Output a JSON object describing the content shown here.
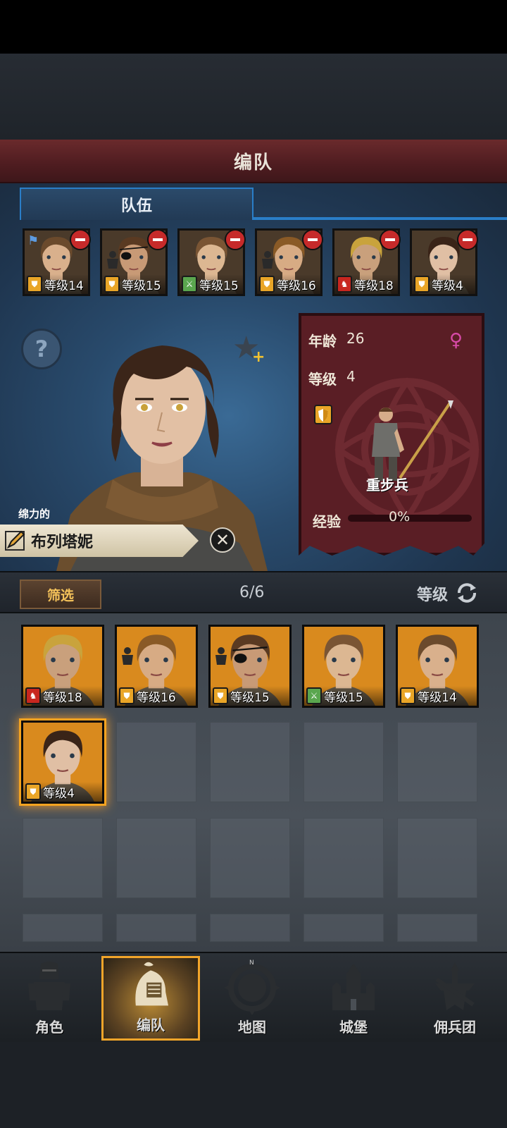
{
  "title": "编队",
  "tab": {
    "label": "队伍"
  },
  "team": [
    {
      "level": "等级14",
      "class_icon": "shield",
      "hair": "#6b4a2c",
      "skin": "#d9b08c",
      "flag": true
    },
    {
      "level": "等级15",
      "class_icon": "shield",
      "hair": "#5a3a22",
      "skin": "#c89a76",
      "eyepatch": true,
      "figure": true
    },
    {
      "level": "等级15",
      "class_icon": "swords",
      "hair": "#7a5534",
      "skin": "#dcb792"
    },
    {
      "level": "等级16",
      "class_icon": "shield",
      "hair": "#8a5a26",
      "skin": "#d7ab84",
      "figure": true
    },
    {
      "level": "等级18",
      "class_icon": "horse",
      "hair": "#c9a33c",
      "skin": "#c9a07c"
    },
    {
      "level": "等级4",
      "class_icon": "shield",
      "hair": "#3a2418",
      "skin": "#e0bfa4"
    }
  ],
  "hero": {
    "trait": "绵力的",
    "name": "布列塔妮",
    "age_label": "年龄",
    "age": "26",
    "level_label": "等级",
    "level": "4",
    "class_name": "重步兵",
    "exp_label": "经验",
    "exp_percent": "0%",
    "exp_fraction": 0
  },
  "filter": {
    "button": "筛选",
    "count": "6/6",
    "sort_label": "等级"
  },
  "roster": [
    {
      "level": "等级18",
      "class_icon": "horse",
      "hair": "#c9a33c",
      "skin": "#c9a07c"
    },
    {
      "level": "等级16",
      "class_icon": "shield",
      "hair": "#8a5a26",
      "skin": "#d7ab84",
      "figure": true
    },
    {
      "level": "等级15",
      "class_icon": "shield",
      "hair": "#5a3a22",
      "skin": "#c89a76",
      "eyepatch": true,
      "figure": true
    },
    {
      "level": "等级15",
      "class_icon": "swords",
      "hair": "#7a5534",
      "skin": "#dcb792"
    },
    {
      "level": "等级14",
      "class_icon": "shield",
      "hair": "#6b4a2c",
      "skin": "#d9b08c"
    },
    {
      "level": "等级4",
      "class_icon": "shield",
      "hair": "#3a2418",
      "skin": "#e0bfa4",
      "selected": true
    }
  ],
  "nav": [
    {
      "label": "角色",
      "icon": "knight-icon"
    },
    {
      "label": "编队",
      "icon": "helmet-icon",
      "active": true
    },
    {
      "label": "地图",
      "icon": "compass-map-icon"
    },
    {
      "label": "城堡",
      "icon": "castle-icon"
    },
    {
      "label": "佣兵团",
      "icon": "mercenary-banner-icon"
    }
  ],
  "colors": {
    "accent_blue": "#2a7ec8",
    "accent_gold": "#f2a52a",
    "title_red": "#5a1e25"
  }
}
